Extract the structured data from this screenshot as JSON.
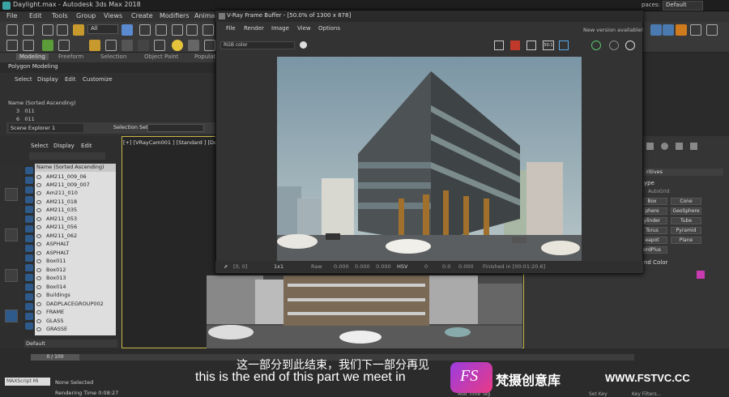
{
  "app": {
    "title": "Daylight.max - Autodesk 3ds Max 2018",
    "workspace_label": "paces:",
    "workspace_value": "Default"
  },
  "menubar": [
    "File",
    "Edit",
    "Tools",
    "Group",
    "Views",
    "Create",
    "Modifiers",
    "Animat"
  ],
  "toolbar": {
    "selection_filter": "All"
  },
  "ribbon": {
    "tabs": [
      "Modeling",
      "Freeform",
      "Selection",
      "Object Paint",
      "Populat"
    ],
    "sub_tab": "Polygon Modeling"
  },
  "scene_explorer_top": {
    "menu": [
      "Select",
      "Display",
      "Edit",
      "Customize"
    ],
    "header": "Name (Sorted Ascending)",
    "rows": [
      {
        "num": "3",
        "name": "011"
      },
      {
        "num": "6",
        "name": "011"
      }
    ],
    "explorer_name": "Scene Explorer 1",
    "selection_set_label": "Selection Set:"
  },
  "left_explorer": {
    "menu": [
      "Select",
      "Display",
      "Edit"
    ],
    "header": "Name (Sorted Ascending)",
    "items": [
      "AM211_009_06",
      "AM211_009_007",
      "Am211_010",
      "AM211_018",
      "AM211_035",
      "AM211_053",
      "AM211_056",
      "AM211_062",
      "ASPHALT",
      "ASPHALT",
      "Box011",
      "Box012",
      "Box013",
      "Box014",
      "Buildings",
      "DADPLACEGROUP002",
      "FRAME",
      "GLASS",
      "GRASSE"
    ],
    "layer": "Default"
  },
  "viewport": {
    "label": "[+] [VRayCam001 ] [Standard ] [Defa..."
  },
  "vfb": {
    "title": "V-Ray Frame Buffer - [50.0% of 1300 x 878]",
    "menu": [
      "File",
      "Render",
      "Image",
      "View",
      "Options"
    ],
    "new_version": "New version available!",
    "channel": "RGB color",
    "zoom_btn": "50:1",
    "status": {
      "coords": "[0, 0]",
      "ratio": "1x1",
      "raw": "Raw",
      "raw_vals": [
        "0.000",
        "0.000",
        "0.000"
      ],
      "mode": "HSV",
      "hsv_vals": [
        "0",
        "0.0",
        "0.000"
      ],
      "finished": "Finished in [00:01:20.6]"
    }
  },
  "command_panel": {
    "rollout": "ritives",
    "type_header": "ype",
    "autogrid": "AutoGrid",
    "buttons": [
      "Box",
      "Cone",
      "phere",
      "GeoSphere",
      "ylinder",
      "Tube",
      "Torus",
      "Pyramid",
      "eapot",
      "Plane",
      "ordPlus"
    ],
    "color_header": "nd Color"
  },
  "bottom": {
    "frame": "0 / 100",
    "maxscript": "MAXScript Mi",
    "status1": "None Selected",
    "status2": "Rendering Time 0:08:27",
    "add_time_tag": "Add Time Tag",
    "set_key": "Set Key",
    "key_filters": "Key Filters..."
  },
  "subtitle": {
    "cn": "这一部分到此结束，我们下一部分再见",
    "en": "this is the end of this part we meet in"
  },
  "watermark": {
    "logo": "FS",
    "brand": "梵摄创意库",
    "site": "WWW.FSTVC.CC"
  },
  "colors": {
    "accent": "#2d5a8a",
    "viewport_border": "#c8b84a",
    "logo": "#c93bb0"
  }
}
